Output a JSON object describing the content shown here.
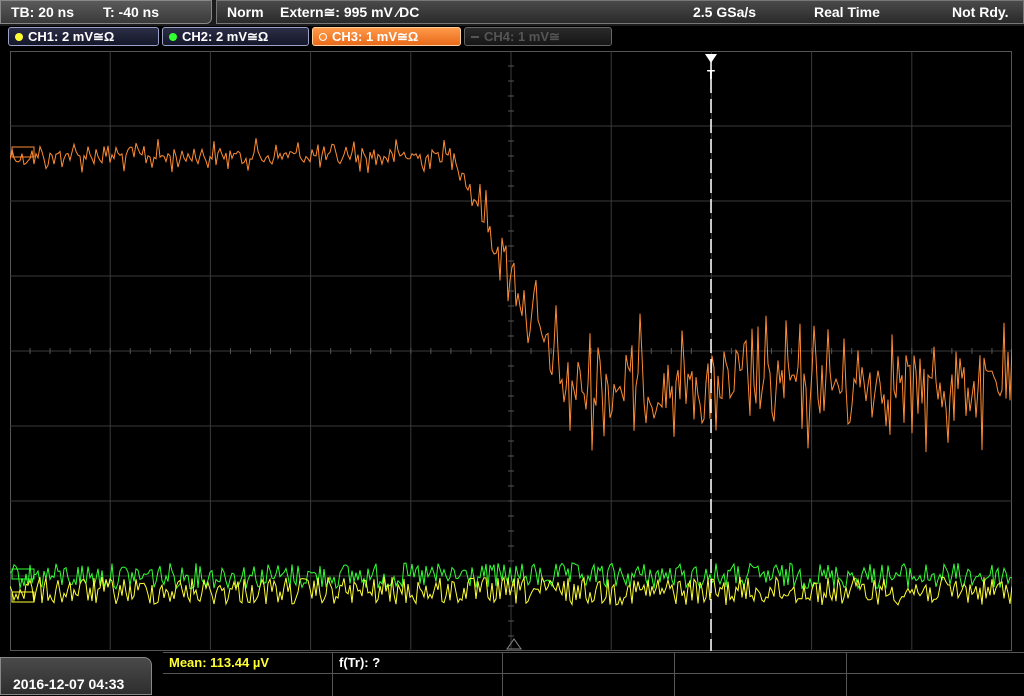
{
  "timebase": {
    "tb": "TB: 20 ns",
    "t": "T: -40 ns"
  },
  "status": {
    "mode": "Norm",
    "trigger": "Extern≅: 995 mV ⁄DC",
    "sample_rate": "2.5 GSa/s",
    "acq": "Real Time",
    "state": "Not Rdy."
  },
  "channels": [
    {
      "label": "CH1: 2 mV≅Ω",
      "color": "#ffff33"
    },
    {
      "label": "CH2: 2 mV≅Ω",
      "color": "#33ff33"
    },
    {
      "label": "CH3: 1 mV≅Ω",
      "color": "#ff8c33"
    },
    {
      "label": "CH4: 1 mV≅",
      "color": "#555555"
    }
  ],
  "markers": {
    "trigger": "T"
  },
  "datetime": "2016-12-07 04:33",
  "measurements": {
    "mean": "Mean: 113.44 µV",
    "ftr": "f(Tr): ?"
  },
  "colors": {
    "ch1": "#ffff33",
    "ch2": "#33ff33",
    "ch3": "#ff8c33",
    "grid": "#3a3a3a"
  }
}
